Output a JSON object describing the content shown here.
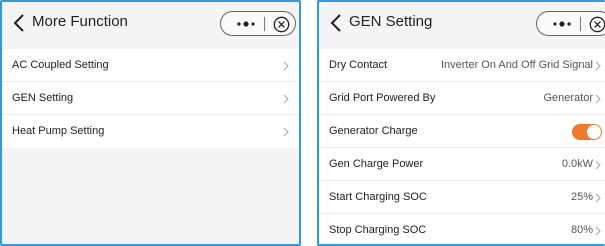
{
  "left_screen": {
    "header": {
      "title": "More Function"
    },
    "items": [
      {
        "label": "AC Coupled Setting"
      },
      {
        "label": "GEN Setting"
      },
      {
        "label": "Heat Pump Setting"
      }
    ]
  },
  "right_screen": {
    "header": {
      "title": "GEN Setting"
    },
    "rows": {
      "dry_contact": {
        "label": "Dry Contact",
        "value": "Inverter On And Off Grid Signal"
      },
      "grid_port": {
        "label": "Grid Port Powered By",
        "value": "Generator"
      },
      "generator_charge": {
        "label": "Generator Charge",
        "enabled": true
      },
      "gen_charge_power": {
        "label": "Gen Charge Power",
        "value": "0.0kW"
      },
      "start_soc": {
        "label": "Start Charging SOC",
        "value": "25%"
      },
      "stop_soc": {
        "label": "Stop Charging SOC",
        "value": "80%"
      }
    }
  },
  "icons": {
    "back": "chevron-left-icon",
    "menu": "more-dots-icon",
    "close": "circle-x-icon",
    "row_arrow": "chevron-right-icon"
  },
  "colors": {
    "frame": "#2e9ae6",
    "toggle_on": "#f07a2b",
    "background": "#f4f4f6"
  }
}
